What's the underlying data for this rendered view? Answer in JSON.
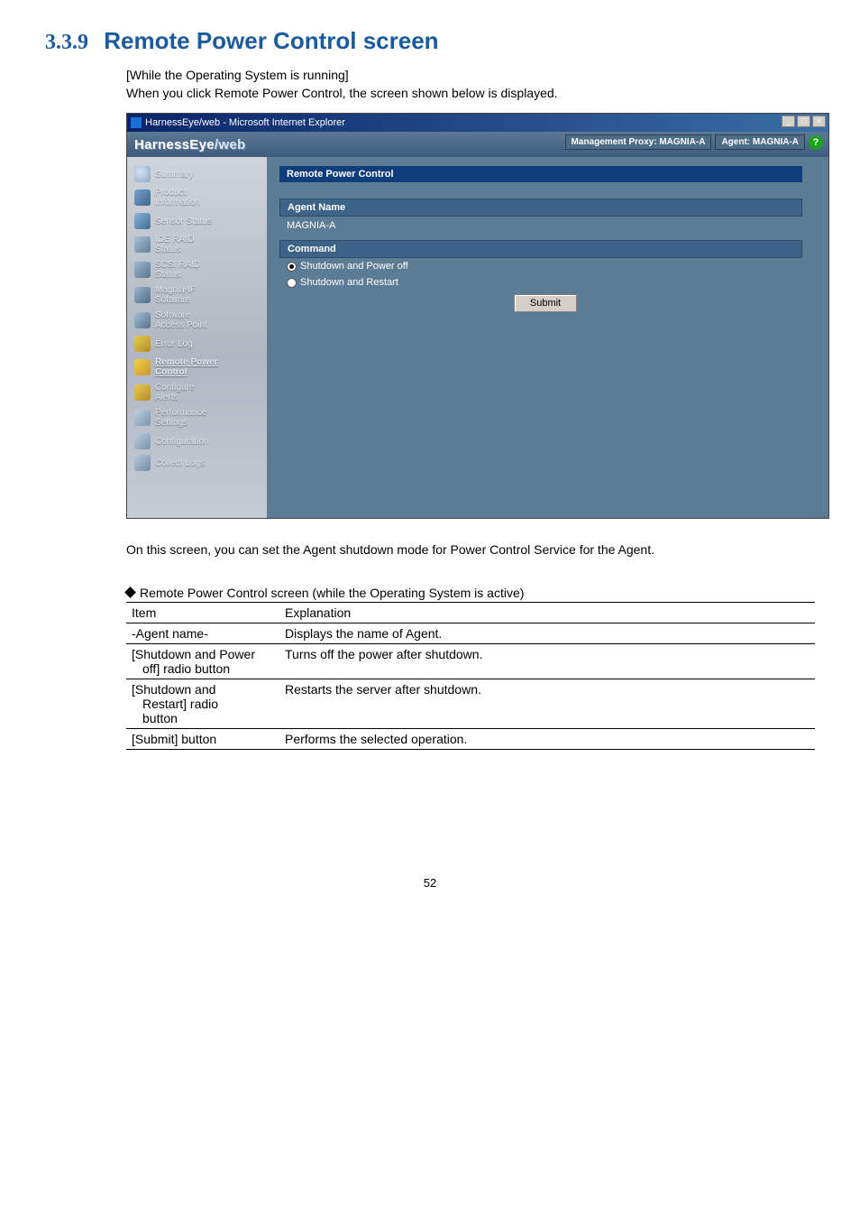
{
  "section": {
    "number": "3.3.9",
    "title": "Remote Power Control screen"
  },
  "intro": {
    "line1": "[While the Operating System is running]",
    "line2": "When you click Remote Power Control, the screen shown below is displayed."
  },
  "window": {
    "title": "HarnessEye/web - Microsoft Internet Explorer",
    "buttons": {
      "min": "_",
      "max": "□",
      "close": "×"
    },
    "app_brand": "HarnessEye",
    "app_suffix": "/web",
    "proxy_label": "Management Proxy: MAGNIA-A",
    "agent_label": "Agent: MAGNIA-A",
    "help": "?"
  },
  "sidebar": [
    {
      "label": "Summary"
    },
    {
      "label": "Product\nInformation"
    },
    {
      "label": "Sensor Status"
    },
    {
      "label": "IDE RAID\nStatus"
    },
    {
      "label": "SCSI RAID\nStatus"
    },
    {
      "label": "Magnia-IF\nSoftware"
    },
    {
      "label": "Software\nAccess Point"
    },
    {
      "label": "Error Log"
    },
    {
      "label": "Remote Power\nControl"
    },
    {
      "label": "Configure\nAlerts"
    },
    {
      "label": "Performance\nSettings"
    },
    {
      "label": "Configuration"
    },
    {
      "label": "Collect Logs"
    }
  ],
  "panel": {
    "title": "Remote Power Control",
    "agent_name_header": "Agent Name",
    "agent_name_value": "MAGNIA-A",
    "command_header": "Command",
    "option1": "Shutdown and Power off",
    "option2": "Shutdown and Restart",
    "submit": "Submit"
  },
  "after_text": "On this screen, you can set the Agent shutdown mode for Power Control Service for the Agent.",
  "table_caption": "Remote Power Control screen (while the Operating System is active)",
  "table": {
    "headers": {
      "item": "Item",
      "explanation": "Explanation"
    },
    "rows": [
      {
        "item_line1": "-Agent name-",
        "item_line2": "",
        "explanation": "Displays the name of Agent."
      },
      {
        "item_line1": "[Shutdown and Power",
        "item_line2": "off] radio button",
        "explanation": "Turns off the power after shutdown."
      },
      {
        "item_line1": "[Shutdown and",
        "item_line2": "Restart] radio",
        "item_line3": "button",
        "explanation": "Restarts the server after shutdown."
      },
      {
        "item_line1": "[Submit] button",
        "item_line2": "",
        "explanation": "Performs the selected operation."
      }
    ]
  },
  "page_number": "52"
}
